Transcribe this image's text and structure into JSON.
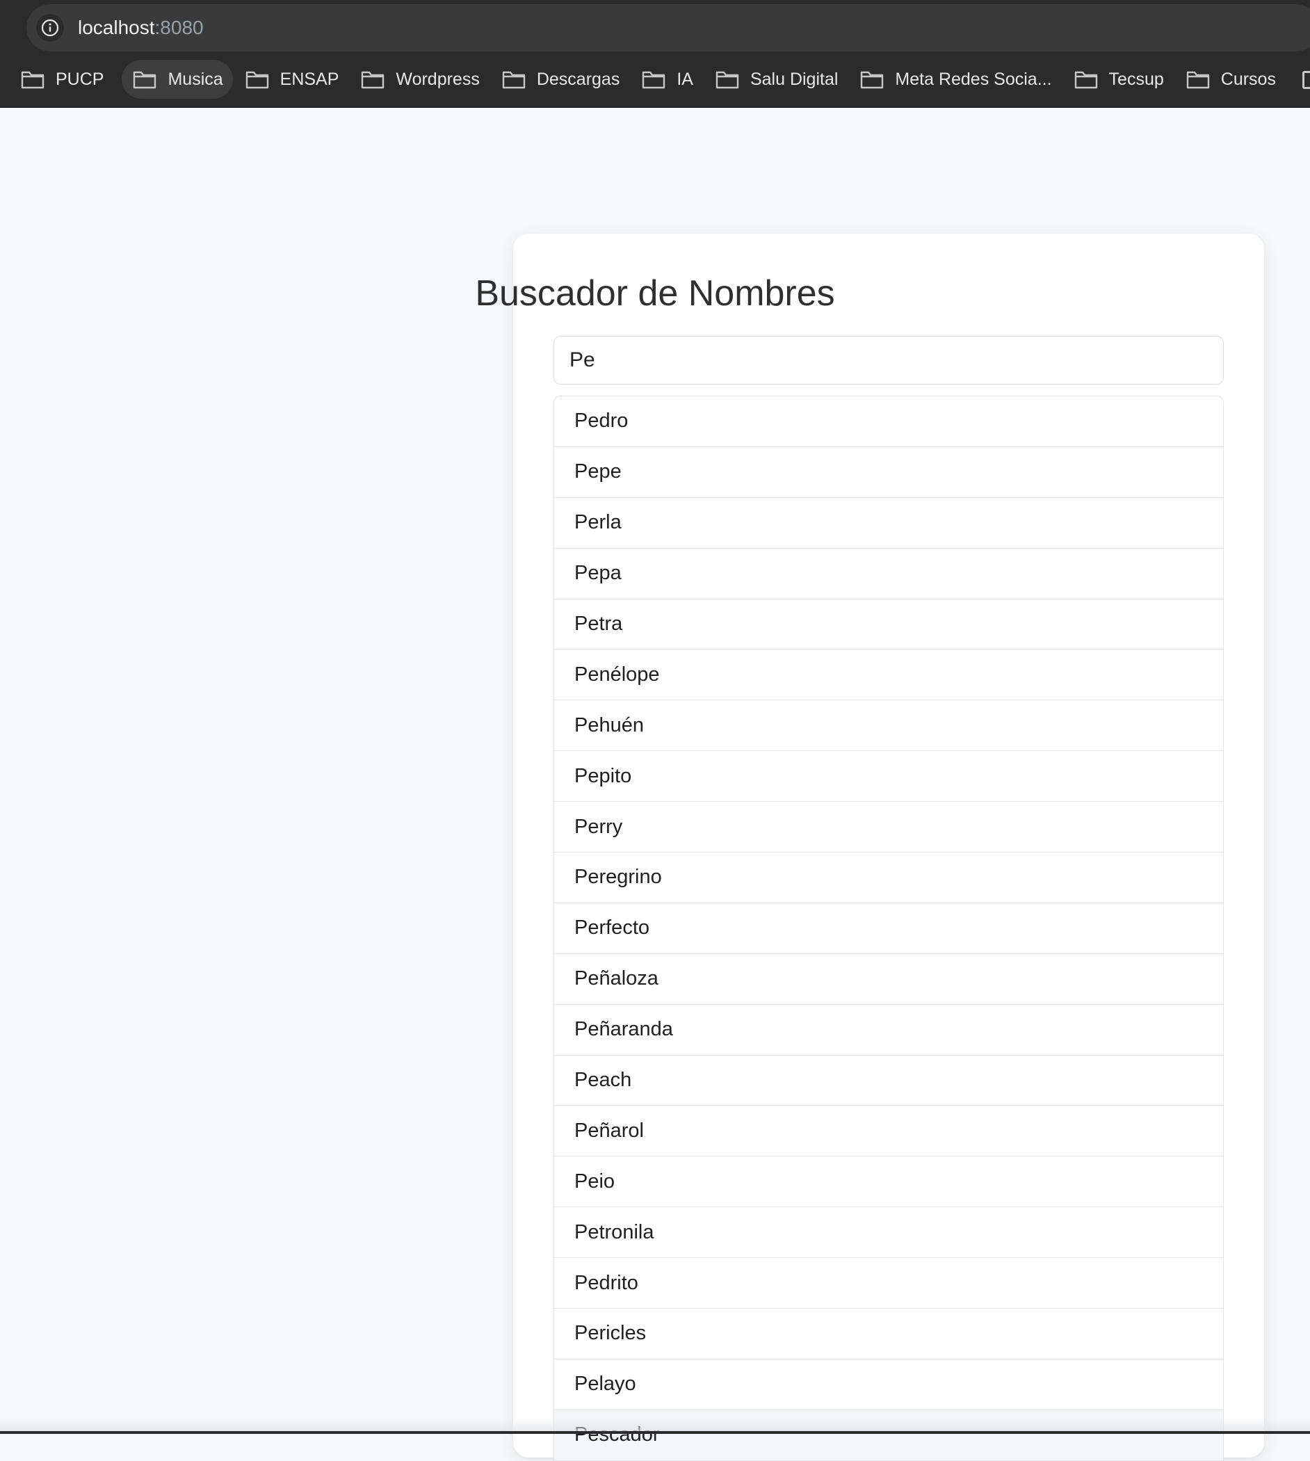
{
  "browser": {
    "url_host": "localhost",
    "url_port": ":8080",
    "bookmarks": [
      {
        "label": "PUCP",
        "icon": "folder-icon"
      },
      {
        "label": "Musica",
        "icon": "folder-icon"
      },
      {
        "label": "ENSAP",
        "icon": "folder-icon"
      },
      {
        "label": "Wordpress",
        "icon": "folder-icon"
      },
      {
        "label": "Descargas",
        "icon": "folder-icon"
      },
      {
        "label": "IA",
        "icon": "folder-icon"
      },
      {
        "label": "Salu Digital",
        "icon": "folder-icon"
      },
      {
        "label": "Meta Redes Socia...",
        "icon": "folder-icon"
      },
      {
        "label": "Tecsup",
        "icon": "folder-icon"
      },
      {
        "label": "Cursos",
        "icon": "folder-icon"
      }
    ]
  },
  "page": {
    "title": "Buscador de Nombres",
    "search_value": "Pe",
    "results": [
      "Pedro",
      "Pepe",
      "Perla",
      "Pepa",
      "Petra",
      "Penélope",
      "Pehuén",
      "Pepito",
      "Perry",
      "Peregrino",
      "Perfecto",
      "Peñaloza",
      "Peñaranda",
      "Peach",
      "Peñarol",
      "Peio",
      "Petronila",
      "Pedrito",
      "Pericles",
      "Pelayo",
      "Pescador"
    ]
  },
  "colors": {
    "chrome_bg": "#2b2b2c",
    "page_bg": "#f7f8fa",
    "card_bg": "#ffffff",
    "text": "#1f1f1f"
  }
}
